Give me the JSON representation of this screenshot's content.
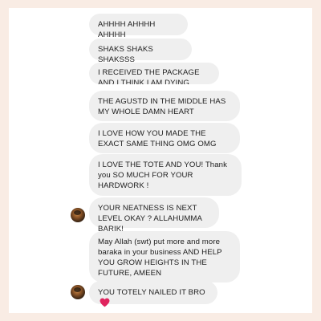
{
  "messages": [
    {
      "text": "AHHHH AHHHH AHHHH"
    },
    {
      "text": "SHAKS SHAKS SHAKSSS"
    },
    {
      "text": "I RECEIVED THE PACKAGE AND I THINK I AM DYING"
    },
    {
      "text": "THE AGUSTD IN THE MIDDLE HAS MY WHOLE DAMN HEART"
    },
    {
      "text": "I LOVE HOW YOU MADE THE EXACT SAME THING OMG OMG"
    },
    {
      "text": "I LOVE THE TOTE AND YOU! Thank you SO MUCH FOR YOUR HARDWORK !"
    },
    {
      "text": "YOUR NEATNESS IS NEXT LEVEL OKAY ? ALLAHUMMA BARIK!"
    },
    {
      "text": "May Allah (swt) put more and more baraka in your business AND HELP YOU GROW HEIGHTS IN THE FUTURE, AMEEN"
    },
    {
      "text": "YOU TOTELY NAILED IT BRO",
      "emoji": "red-heart"
    }
  ],
  "colors": {
    "page_bg": "#f9ece4",
    "card_bg": "#ffffff",
    "bubble_bg": "#efefef",
    "text": "#1d1d1d",
    "heart": "#e0245e"
  }
}
